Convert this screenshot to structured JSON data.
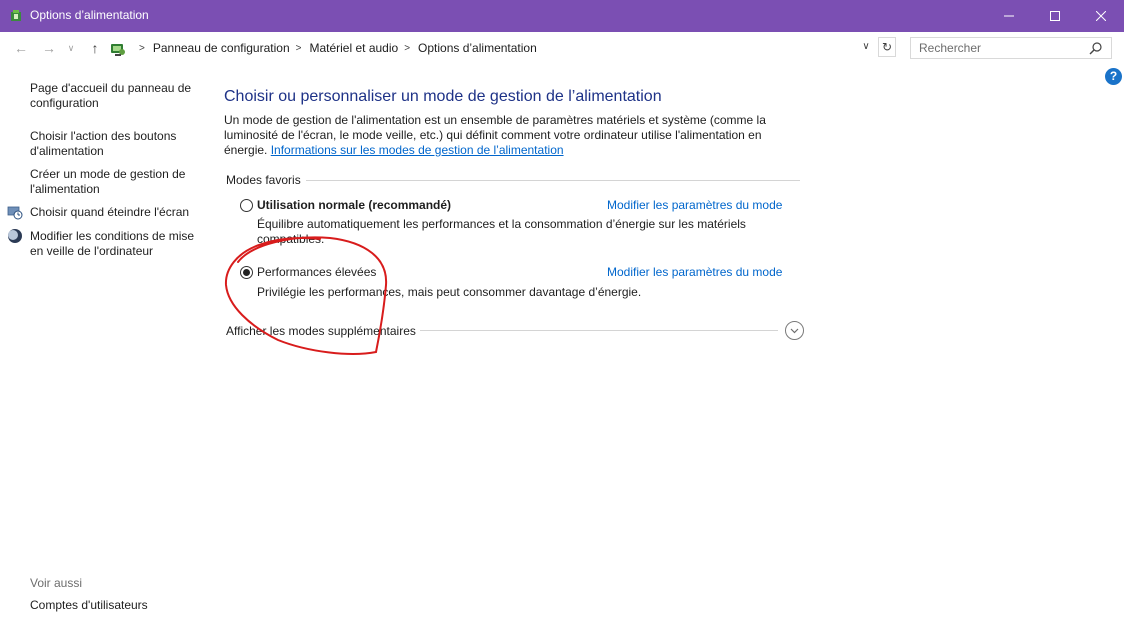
{
  "window": {
    "title": "Options d’alimentation"
  },
  "nav": {
    "breadcrumbs": [
      "Panneau de configuration",
      "Matériel et audio",
      "Options d’alimentation"
    ],
    "search_placeholder": "Rechercher"
  },
  "sidebar": {
    "items": [
      {
        "label": "Page d'accueil du panneau de configuration",
        "icon": ""
      },
      {
        "label": "Choisir l'action des boutons d'alimentation",
        "icon": ""
      },
      {
        "label": "Créer un mode de gestion de l'alimentation",
        "icon": ""
      },
      {
        "label": "Choisir quand éteindre l'écran",
        "icon": "clock-monitor-icon"
      },
      {
        "label": "Modifier les conditions de mise en veille de l'ordinateur",
        "icon": "moon-icon"
      }
    ],
    "see_also": "Voir aussi",
    "accounts_link": "Comptes d'utilisateurs"
  },
  "main": {
    "heading": "Choisir ou personnaliser un mode de gestion de l’alimentation",
    "description": "Un mode de gestion de l'alimentation est un ensemble de paramètres matériels et système (comme la luminosité de l'écran, le mode veille, etc.) qui définit comment votre ordinateur utilise l'alimentation en énergie.",
    "info_link": "Informations sur les modes de gestion de l’alimentation",
    "favorites_label": "Modes favoris",
    "plans": [
      {
        "name": "Utilisation normale (recommandé)",
        "description": "Équilibre automatiquement les performances et la consommation d’énergie sur les matériels compatibles.",
        "selected": false,
        "link": "Modifier les paramètres du mode"
      },
      {
        "name": "Performances élevées",
        "description": "Privilégie les performances, mais peut consommer davantage d’énergie.",
        "selected": true,
        "link": "Modifier les paramètres du mode"
      }
    ],
    "more_plans": "Afficher les modes supplémentaires"
  },
  "colors": {
    "titlebar": "#7b4fb3",
    "heading": "#1e3287",
    "link": "#0066cc",
    "annotation": "#d81c1c"
  }
}
